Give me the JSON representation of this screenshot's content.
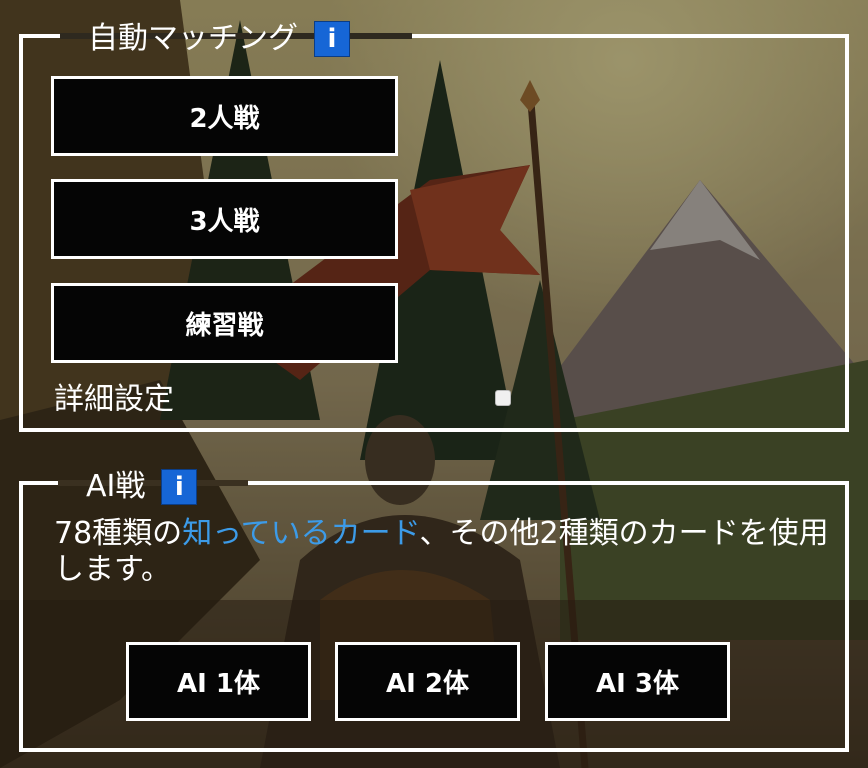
{
  "auto_match": {
    "title": "自動マッチング",
    "info_icon": "info-icon",
    "buttons": {
      "two_player": "2人戦",
      "three_player": "3人戦",
      "practice": "練習戦"
    },
    "detail_settings_label": "詳細設定",
    "detail_settings_checked": false
  },
  "ai_battle": {
    "title": "AI戦",
    "info_icon": "info-icon",
    "description": {
      "prefix": "78種類の",
      "link": "知っているカード",
      "suffix": "、その他2種類のカードを使用します。"
    },
    "buttons": {
      "ai1": "AI 1体",
      "ai2": "AI 2体",
      "ai3": "AI 3体"
    }
  },
  "colors": {
    "info_blue": "#1666d6",
    "link_blue": "#3c9be8",
    "border": "#ffffff"
  }
}
